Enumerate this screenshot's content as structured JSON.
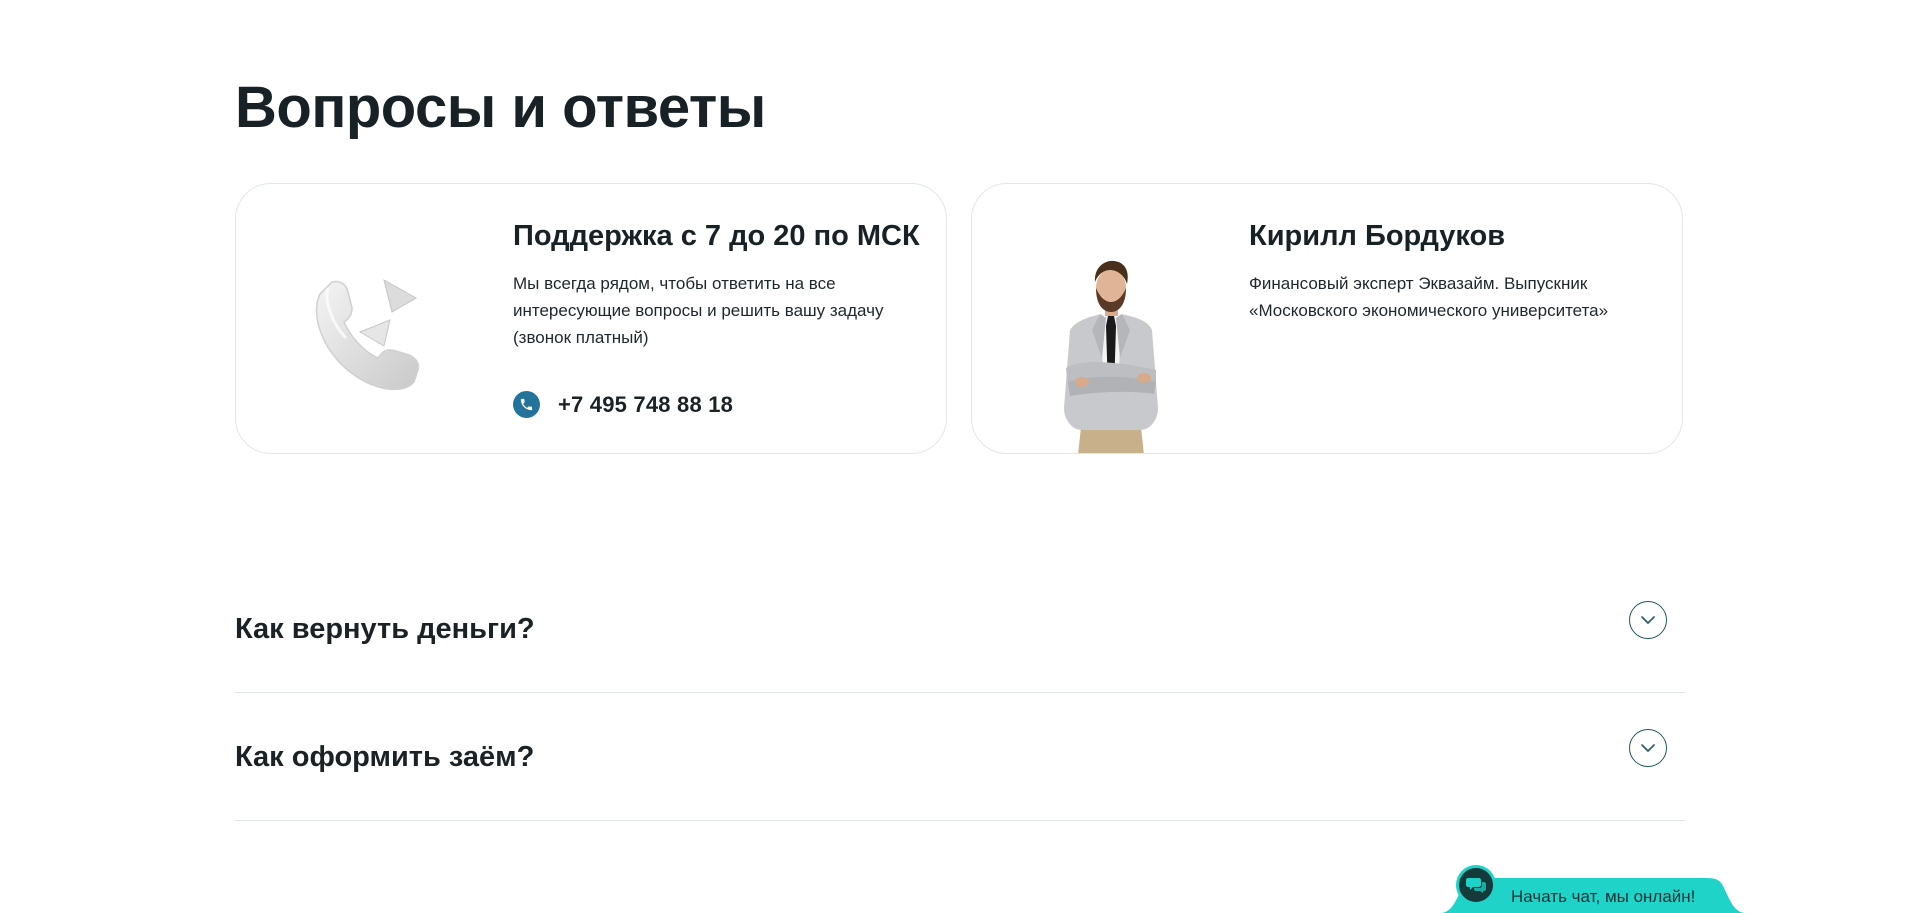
{
  "section": {
    "title": "Вопросы и ответы"
  },
  "support_card": {
    "title": "Поддержка с 7 до 20 по МСК",
    "text": "Мы всегда рядом, чтобы ответить на все интересующие вопросы и решить вашу задачу (звонок платный)",
    "phone": "+7 495 748 88 18",
    "icon": "phone-icon",
    "illustration": "phone-handset-illustration"
  },
  "expert_card": {
    "name": "Кирилл Бордуков",
    "description": "Финансовый эксперт Эквазайм. Выпускник «Московского экономического университета»",
    "photo": "expert-photo"
  },
  "faq": [
    {
      "question": "Как вернуть деньги?",
      "icon": "chevron-down-icon"
    },
    {
      "question": "Как оформить заём?",
      "icon": "chevron-down-icon"
    }
  ],
  "chat_widget": {
    "label": "Начать чат, мы онлайн!",
    "icon": "chat-bubbles-icon"
  },
  "colors": {
    "accent": "#24739a",
    "chat_background": "#1fd3c9",
    "chat_avatar": "#153a3a",
    "toggle_border": "#1f5a63",
    "text": "#1b2226",
    "border": "#e2e6e8"
  }
}
